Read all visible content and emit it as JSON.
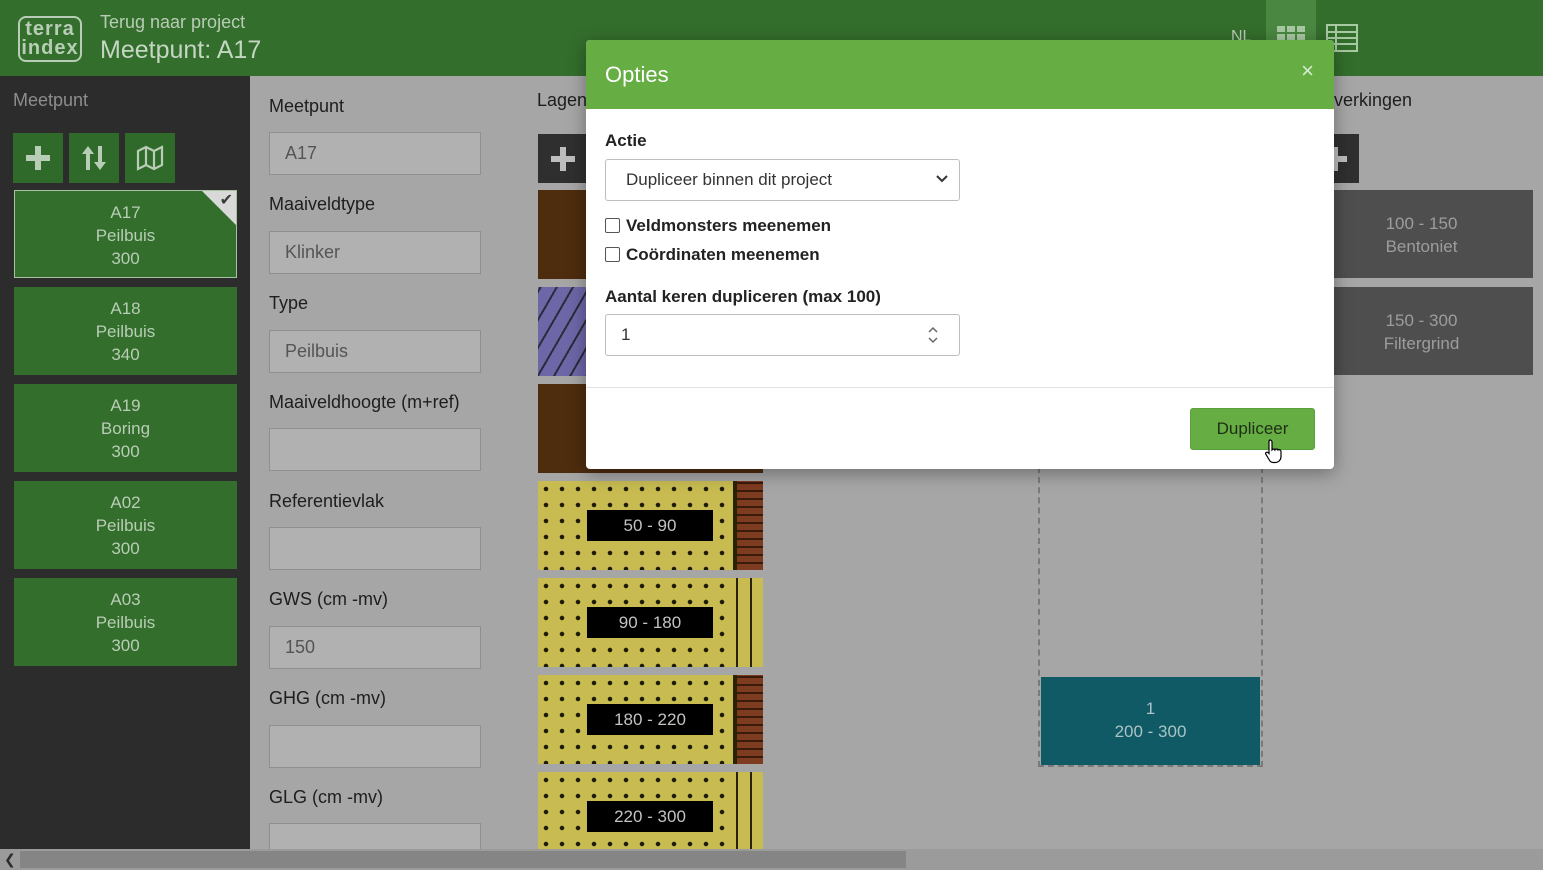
{
  "header": {
    "logo_line1": "terra",
    "logo_line2": "index",
    "back_link": "Terug naar project",
    "title": "Meetpunt: A17",
    "language": "NL"
  },
  "sidebar": {
    "title": "Meetpunt",
    "tools": [
      "plus-icon",
      "sort-icon",
      "map-icon"
    ],
    "points": [
      {
        "name": "A17",
        "type": "Peilbuis",
        "depth": "300",
        "active": true
      },
      {
        "name": "A18",
        "type": "Peilbuis",
        "depth": "340",
        "active": false
      },
      {
        "name": "A19",
        "type": "Boring",
        "depth": "300",
        "active": false
      },
      {
        "name": "A02",
        "type": "Peilbuis",
        "depth": "300",
        "active": false
      },
      {
        "name": "A03",
        "type": "Peilbuis",
        "depth": "300",
        "active": false
      }
    ]
  },
  "form": {
    "fields": [
      {
        "label": "Meetpunt",
        "value": "A17"
      },
      {
        "label": "Maaiveldtype",
        "value": "Klinker"
      },
      {
        "label": "Type",
        "value": "Peilbuis"
      },
      {
        "label": "Maaiveldhoogte (m+ref)",
        "value": ""
      },
      {
        "label": "Referentievlak",
        "value": ""
      },
      {
        "label": "GWS (cm -mv)",
        "value": "150"
      },
      {
        "label": "GHG (cm -mv)",
        "value": ""
      },
      {
        "label": "GLG (cm -mv)",
        "value": ""
      }
    ]
  },
  "lagen": {
    "title": "Lagen",
    "layers": [
      {
        "label": "",
        "pattern": "brown"
      },
      {
        "label": "",
        "pattern": "hatch"
      },
      {
        "label": "",
        "pattern": "brown"
      },
      {
        "label": "50 - 90",
        "pattern": "sand"
      },
      {
        "label": "90 - 180",
        "pattern": "sand"
      },
      {
        "label": "180 - 220",
        "pattern": "sand"
      },
      {
        "label": "220 - 300",
        "pattern": "sand"
      }
    ]
  },
  "filters": {
    "block_number": "1",
    "block_range": "200 - 300"
  },
  "bewerkingen": {
    "title": "verkingen",
    "items": [
      {
        "range": "100 - 150",
        "material": "Bentoniet"
      },
      {
        "range": "150 - 300",
        "material": "Filtergrind"
      }
    ]
  },
  "modal": {
    "title": "Opties",
    "close": "×",
    "action_label": "Actie",
    "action_value": "Dupliceer binnen dit project",
    "check_samples": "Veldmonsters meenemen",
    "check_coords": "Coördinaten meenemen",
    "count_label": "Aantal keren dupliceren (max 100)",
    "count_value": "1",
    "submit": "Dupliceer"
  },
  "colors": {
    "header": "#336e2c",
    "modal_accent": "#66ad44",
    "filter": "#0f5a64"
  }
}
